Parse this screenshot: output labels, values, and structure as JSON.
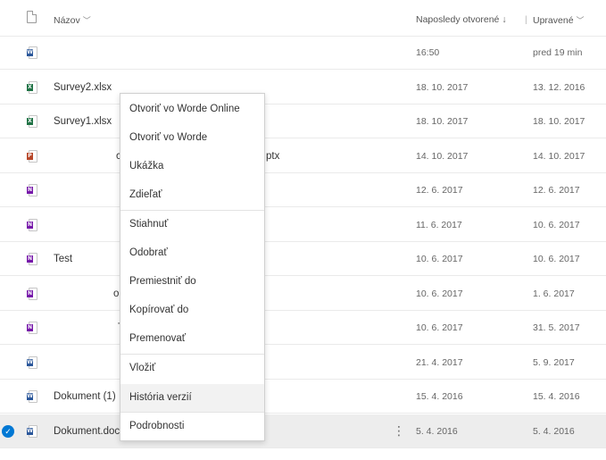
{
  "header": {
    "name_label": "Názov",
    "last_opened_label": "Naposledy otvorené",
    "sort_indicator": "↓",
    "modified_label": "Upravené",
    "chevron": "﹀"
  },
  "rows": [
    {
      "type": "word",
      "badge": "W",
      "name": "",
      "opened": "16:50",
      "modified": "pred 19 min"
    },
    {
      "type": "excel",
      "badge": "X",
      "name": "Survey2.xlsx",
      "opened": "18. 10. 2017",
      "modified": "13. 12. 2016"
    },
    {
      "type": "excel",
      "badge": "X",
      "name": "Survey1.xlsx",
      "opened": "18. 10. 2017",
      "modified": "18. 10. 2017"
    },
    {
      "type": "powerpoint",
      "badge": "P",
      "name": "",
      "opened": "14. 10. 2017",
      "modified": "14. 10. 2017"
    },
    {
      "type": "onenote",
      "badge": "N",
      "name": "",
      "opened": "12. 6. 2017",
      "modified": "12. 6. 2017"
    },
    {
      "type": "onenote",
      "badge": "N",
      "name": "",
      "opened": "11. 6. 2017",
      "modified": "10. 6. 2017"
    },
    {
      "type": "onenote",
      "badge": "N",
      "name": "Test",
      "opened": "10. 6. 2017",
      "modified": "10. 6. 2017"
    },
    {
      "type": "onenote",
      "badge": "N",
      "name": "",
      "opened": "10. 6. 2017",
      "modified": "1. 6. 2017"
    },
    {
      "type": "onenote",
      "badge": "N",
      "name": "",
      "opened": "10. 6. 2017",
      "modified": "31. 5. 2017"
    },
    {
      "type": "word",
      "badge": "W",
      "name": "",
      "opened": "21. 4. 2017",
      "modified": "5. 9. 2017"
    },
    {
      "type": "word",
      "badge": "W",
      "name": "Dokument (1)",
      "opened": "15. 4. 2016",
      "modified": "15. 4. 2016"
    },
    {
      "type": "word",
      "badge": "W",
      "name": "Dokument.docx",
      "opened": "5. 4. 2016",
      "modified": "5. 4. 2016",
      "selected": true
    }
  ],
  "fragments": {
    "pptx_suffix": "ptx",
    "row7_char": "o",
    "row8_char": "T",
    "row3_char": "c"
  },
  "selection": {
    "check_glyph": "✓",
    "more_glyph": "⋮"
  },
  "context_menu": {
    "items": [
      "Otvoriť vo Worde Online",
      "Otvoriť vo Worde",
      "Ukážka",
      "Zdieľať",
      "Stiahnuť",
      "Odobrať",
      "Premiestniť do",
      "Kopírovať do",
      "Premenovať",
      "Vložiť",
      "História verzií",
      "Podrobnosti"
    ]
  },
  "colors": {
    "word": "#2b579a",
    "excel": "#217346",
    "powerpoint": "#b7472a",
    "onenote": "#7719aa",
    "accent": "#0078d4"
  }
}
